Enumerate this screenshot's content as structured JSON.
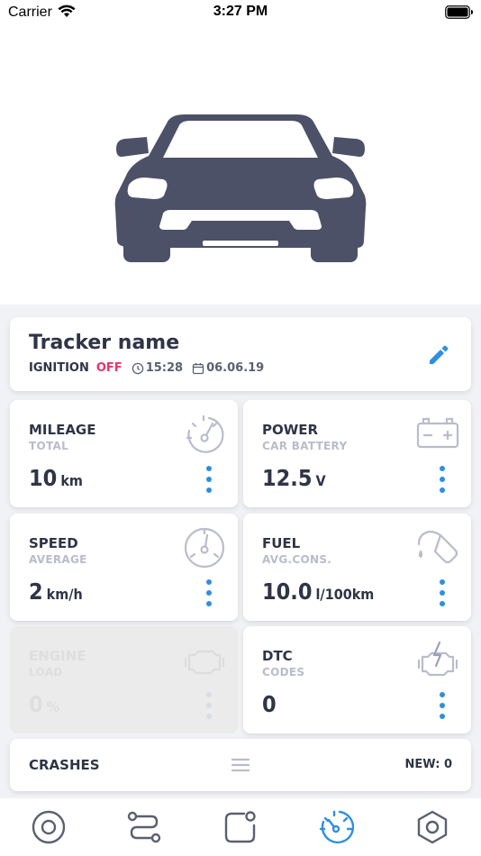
{
  "status_bar": {
    "carrier": "Carrier",
    "time": "3:27 PM"
  },
  "tracker": {
    "name": "Tracker name",
    "ignition_label": "IGNITION",
    "ignition_state": "OFF",
    "time": "15:28",
    "date": "06.06.19"
  },
  "tiles": {
    "mileage": {
      "title": "MILEAGE",
      "subtitle": "TOTAL",
      "value": "10",
      "unit": "km",
      "icon": "odometer-icon"
    },
    "power": {
      "title": "POWER",
      "subtitle": "CAR BATTERY",
      "value": "12.5",
      "unit": "V",
      "icon": "battery-icon"
    },
    "speed": {
      "title": "SPEED",
      "subtitle": "AVERAGE",
      "value": "2",
      "unit": "km/h",
      "icon": "speedometer-icon"
    },
    "fuel": {
      "title": "FUEL",
      "subtitle": "AVG.CONS.",
      "value": "10.0",
      "unit": "l/100km",
      "icon": "fuel-nozzle-icon"
    },
    "engine": {
      "title": "ENGINE",
      "subtitle": "LOAD",
      "value": "0",
      "unit": "%",
      "icon": "engine-icon"
    },
    "dtc": {
      "title": "DTC",
      "subtitle": "CODES",
      "value": "0",
      "unit": "",
      "icon": "engine-warning-icon"
    }
  },
  "crashes": {
    "title": "CRASHES",
    "new_label": "NEW: 0"
  },
  "tabbar": {
    "tabs": [
      {
        "icon": "target-icon"
      },
      {
        "icon": "route-icon"
      },
      {
        "icon": "notification-icon"
      },
      {
        "icon": "dashboard-icon",
        "active": true
      },
      {
        "icon": "settings-icon"
      }
    ]
  },
  "colors": {
    "accent": "#2f8fde",
    "off": "#e8336b",
    "text": "#2f3446",
    "car": "#4c5168",
    "muted": "#b9bccb"
  }
}
